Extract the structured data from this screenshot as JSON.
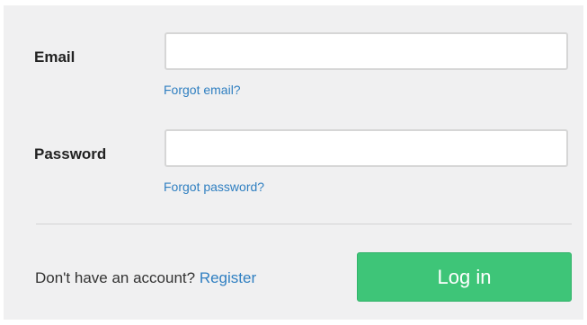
{
  "form": {
    "email": {
      "label": "Email",
      "value": "",
      "placeholder": "",
      "forgot_link": "Forgot email?"
    },
    "password": {
      "label": "Password",
      "value": "",
      "placeholder": "",
      "forgot_link": "Forgot password?"
    }
  },
  "footer": {
    "no_account_text": "Don't have an account?",
    "register_link": "Register",
    "login_button": "Log in"
  },
  "colors": {
    "link": "#2f7fc1",
    "login_button": "#3ec578",
    "panel_background": "#f0f0f1"
  }
}
